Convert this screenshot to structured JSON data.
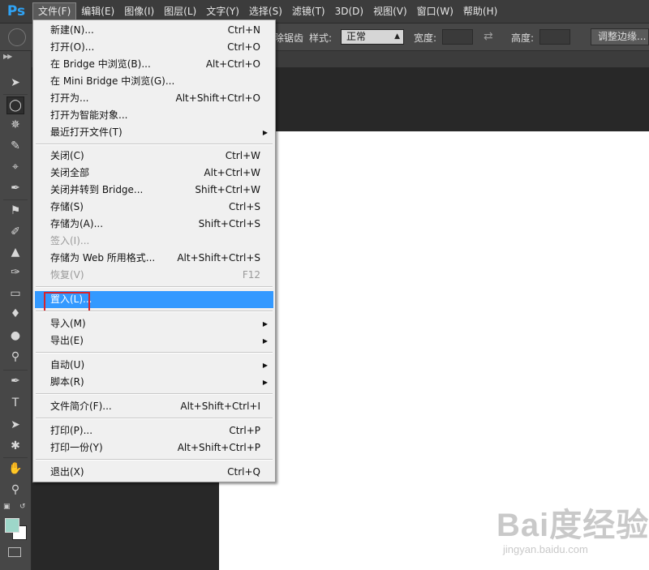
{
  "app": {
    "logo": "Ps"
  },
  "menubar": {
    "items": [
      "文件(F)",
      "编辑(E)",
      "图像(I)",
      "图层(L)",
      "文字(Y)",
      "选择(S)",
      "滤镜(T)",
      "3D(D)",
      "视图(V)",
      "窗口(W)",
      "帮助(H)"
    ]
  },
  "options": {
    "partial_label": "除锯齿",
    "style_label": "样式:",
    "style_value": "正常",
    "width_label": "宽度:",
    "height_label": "高度:",
    "refine_button": "调整边缘..."
  },
  "file_menu": {
    "items": [
      {
        "label": "新建(N)...",
        "shortcut": "Ctrl+N"
      },
      {
        "label": "打开(O)...",
        "shortcut": "Ctrl+O"
      },
      {
        "label": "在 Bridge 中浏览(B)...",
        "shortcut": "Alt+Ctrl+O"
      },
      {
        "label": "在 Mini Bridge 中浏览(G)...",
        "shortcut": ""
      },
      {
        "label": "打开为...",
        "shortcut": "Alt+Shift+Ctrl+O"
      },
      {
        "label": "打开为智能对象...",
        "shortcut": ""
      },
      {
        "label": "最近打开文件(T)",
        "shortcut": ""
      },
      {
        "label": "关闭(C)",
        "shortcut": "Ctrl+W"
      },
      {
        "label": "关闭全部",
        "shortcut": "Alt+Ctrl+W"
      },
      {
        "label": "关闭并转到 Bridge...",
        "shortcut": "Shift+Ctrl+W"
      },
      {
        "label": "存储(S)",
        "shortcut": "Ctrl+S"
      },
      {
        "label": "存储为(A)...",
        "shortcut": "Shift+Ctrl+S"
      },
      {
        "label": "签入(I)...",
        "shortcut": ""
      },
      {
        "label": "存储为 Web 所用格式...",
        "shortcut": "Alt+Shift+Ctrl+S"
      },
      {
        "label": "恢复(V)",
        "shortcut": "F12"
      },
      {
        "label": "置入(L)...",
        "shortcut": ""
      },
      {
        "label": "导入(M)",
        "shortcut": ""
      },
      {
        "label": "导出(E)",
        "shortcut": ""
      },
      {
        "label": "自动(U)",
        "shortcut": ""
      },
      {
        "label": "脚本(R)",
        "shortcut": ""
      },
      {
        "label": "文件简介(F)...",
        "shortcut": "Alt+Shift+Ctrl+I"
      },
      {
        "label": "打印(P)...",
        "shortcut": "Ctrl+P"
      },
      {
        "label": "打印一份(Y)",
        "shortcut": "Alt+Shift+Ctrl+P"
      },
      {
        "label": "退出(X)",
        "shortcut": "Ctrl+Q"
      }
    ]
  },
  "watermark": {
    "text": "Bai度经验",
    "sub": "jingyan.baidu.com"
  },
  "colors": {
    "accent": "#3399ff",
    "highlight_box": "#d8232a",
    "foreground_swatch": "#9dd7c9",
    "background_swatch": "#ffffff"
  }
}
